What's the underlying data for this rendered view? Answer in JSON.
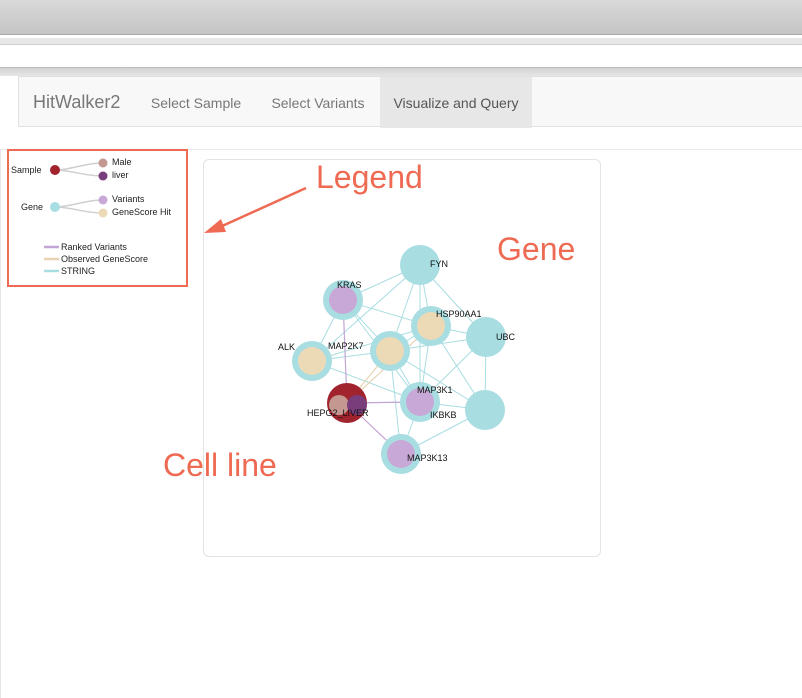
{
  "navbar": {
    "brand": "HitWalker2",
    "items": [
      {
        "label": "Select Sample"
      },
      {
        "label": "Select Variants"
      },
      {
        "label": "Visualize and Query"
      }
    ]
  },
  "legend": {
    "sample": "Sample",
    "male": "Male",
    "liver": "liver",
    "gene": "Gene",
    "variants": "Variants",
    "genescore_hit": "GeneScore Hit",
    "ranked_variants": "Ranked Variants",
    "observed_genescore": "Observed GeneScore",
    "string": "STRING"
  },
  "annotations": {
    "legend": "Legend",
    "gene": "Gene",
    "cell_line": "Cell line"
  },
  "network": {
    "labels": {
      "fyn": "FYN",
      "kras": "KRAS",
      "hsp90aa1": "HSP90AA1",
      "ubc": "UBC",
      "alk": "ALK",
      "map2k7": "MAP2K7",
      "map3k1": "MAP3K1",
      "ikbkb": "IKBKB",
      "hepg2": "HEPG2_LIVER",
      "map3k13": "MAP3K13"
    }
  },
  "colors": {
    "sample": "#a0232e",
    "male": "#c49890",
    "liver": "#7a3d7c",
    "gene": "#a8dde2",
    "variants": "#c8a8d6",
    "genescore_hit": "#ecd9b6",
    "ranked_variants_edge": "#c2a5d4",
    "observed_genescore_edge": "#e8d4b4",
    "string_edge": "#a8dde2",
    "annotation": "#ef6a53"
  }
}
